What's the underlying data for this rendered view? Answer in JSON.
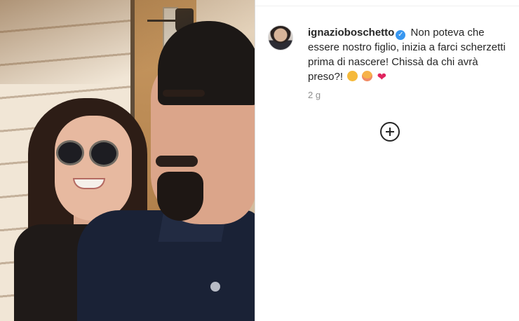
{
  "post": {
    "username": "ignazioboschetto",
    "verified_icon": "verified-badge-icon",
    "caption_text": "Non poteva che essere nostro figlio, inizia a farci scherzetti prima di nascere! Chissà da chi avrà preso?!",
    "caption_emojis": [
      "thinking-face-emoji",
      "flushed-face-emoji",
      "red-heart-emoji"
    ],
    "heart_glyph": "❤",
    "timestamp": "2 g",
    "load_more_icon": "plus-circle-icon"
  },
  "colors": {
    "text": "#262626",
    "secondary": "#8e8e8e",
    "verified": "#3897f0",
    "heart": "#e0245e",
    "divider": "#dbdbdb"
  }
}
